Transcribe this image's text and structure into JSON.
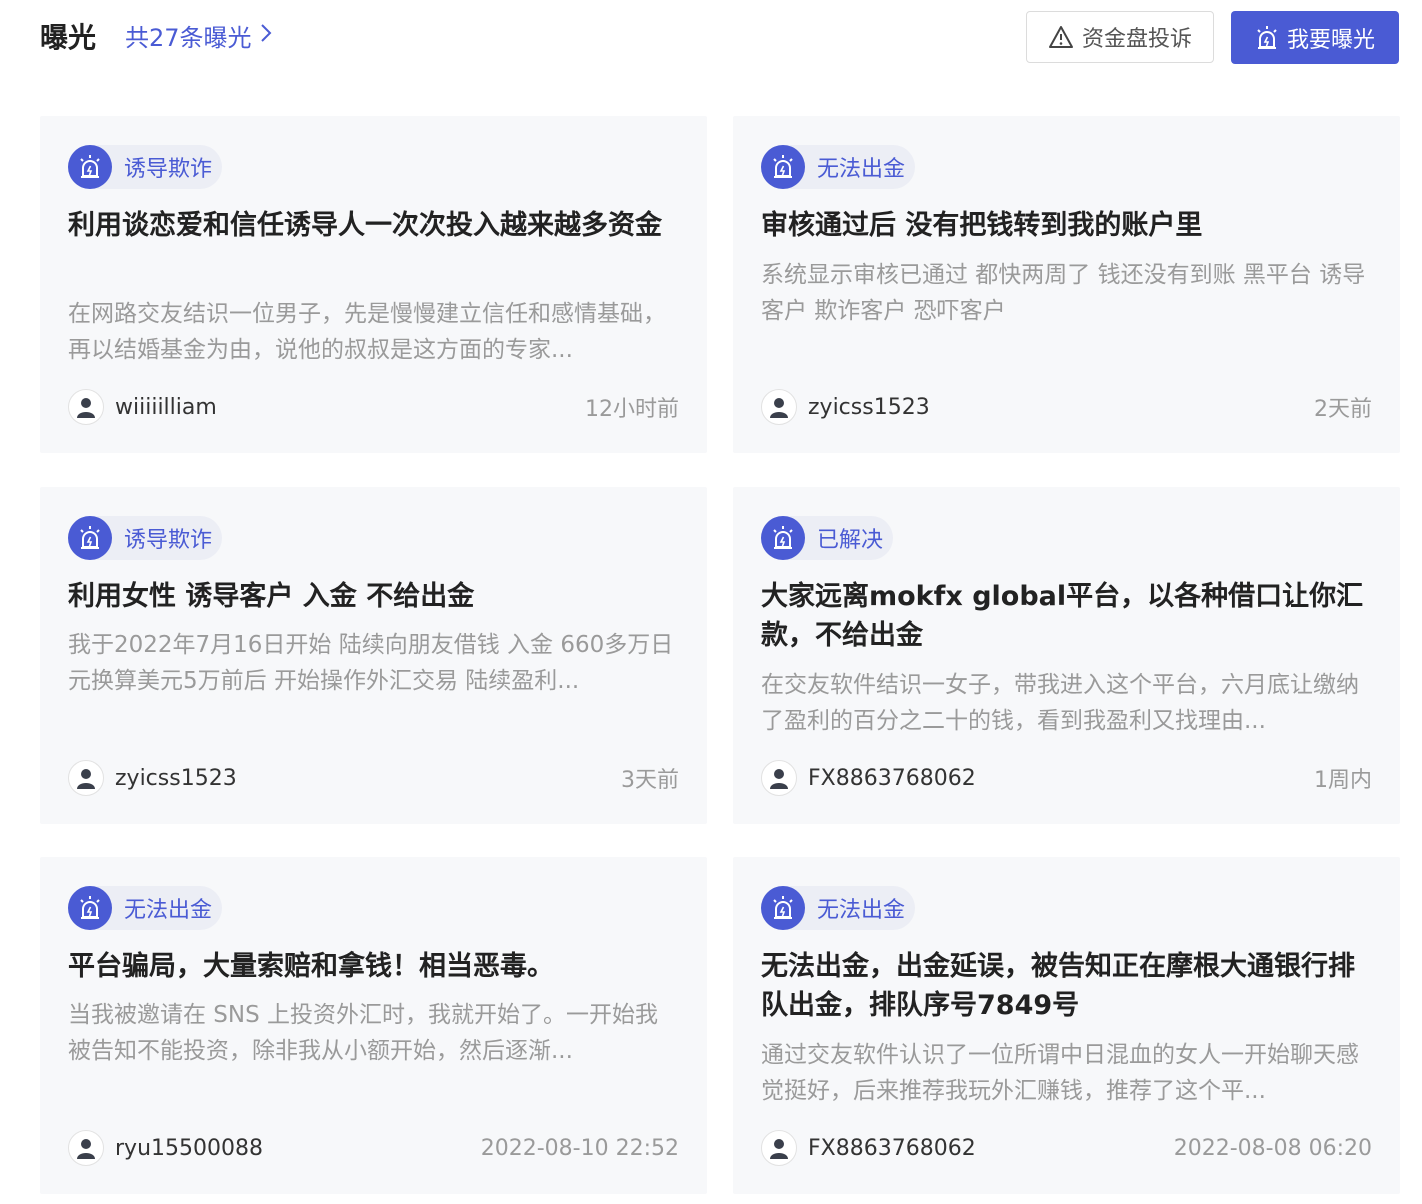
{
  "header": {
    "title": "曝光",
    "count_link": "共27条曝光",
    "complain_button": "资金盘投诉",
    "expose_button": "我要曝光"
  },
  "colors": {
    "accent": "#4a5bd4",
    "card_bg": "#f7f8fa",
    "muted_text": "#9a9a9a"
  },
  "cards": [
    {
      "tag": "诱导欺诈",
      "title": "利用谈恋爱和信任诱导人一次次投入越来越多资金",
      "desc": "在网路交友结识一位男子，先是慢慢建立信任和感情基础，再以结婚基金为由，说他的叔叔是这方面的专家...",
      "user": "wiiiiilliam",
      "time": "12小时前"
    },
    {
      "tag": "无法出金",
      "title": "审核通过后 没有把钱转到我的账户里",
      "desc": "系统显示审核已通过 都快两周了 钱还没有到账 黑平台 诱导客户 欺诈客户 恐吓客户",
      "user": "zyicss1523",
      "time": "2天前"
    },
    {
      "tag": "诱导欺诈",
      "title": "利用女性 诱导客户 入金 不给出金",
      "desc": "我于2022年7月16日开始 陆续向朋友借钱 入金 660多万日元换算美元5万前后 开始操作外汇交易 陆续盈利...",
      "user": "zyicss1523",
      "time": "3天前"
    },
    {
      "tag": "已解决",
      "title": "大家远离mokfx global平台，以各种借口让你汇款，不给出金",
      "desc": "在交友软件结识一女子，带我进入这个平台，六月底让缴纳了盈利的百分之二十的钱，看到我盈利又找理由...",
      "user": "FX8863768062",
      "time": "1周内"
    },
    {
      "tag": "无法出金",
      "title": "平台骗局，大量索赔和拿钱！相当恶毒。",
      "desc": "当我被邀请在 SNS 上投资外汇时，我就开始了。一开始我被告知不能投资，除非我从小额开始，然后逐渐...",
      "user": "ryu15500088",
      "time": "2022-08-10 22:52"
    },
    {
      "tag": "无法出金",
      "title": "无法出金，出金延误，被告知正在摩根大通银行排队出金，排队序号7849号",
      "desc": "通过交友软件认识了一位所谓中日混血的女人一开始聊天感觉挺好，后来推荐我玩外汇赚钱，推荐了这个平...",
      "user": "FX8863768062",
      "time": "2022-08-08 06:20"
    }
  ]
}
